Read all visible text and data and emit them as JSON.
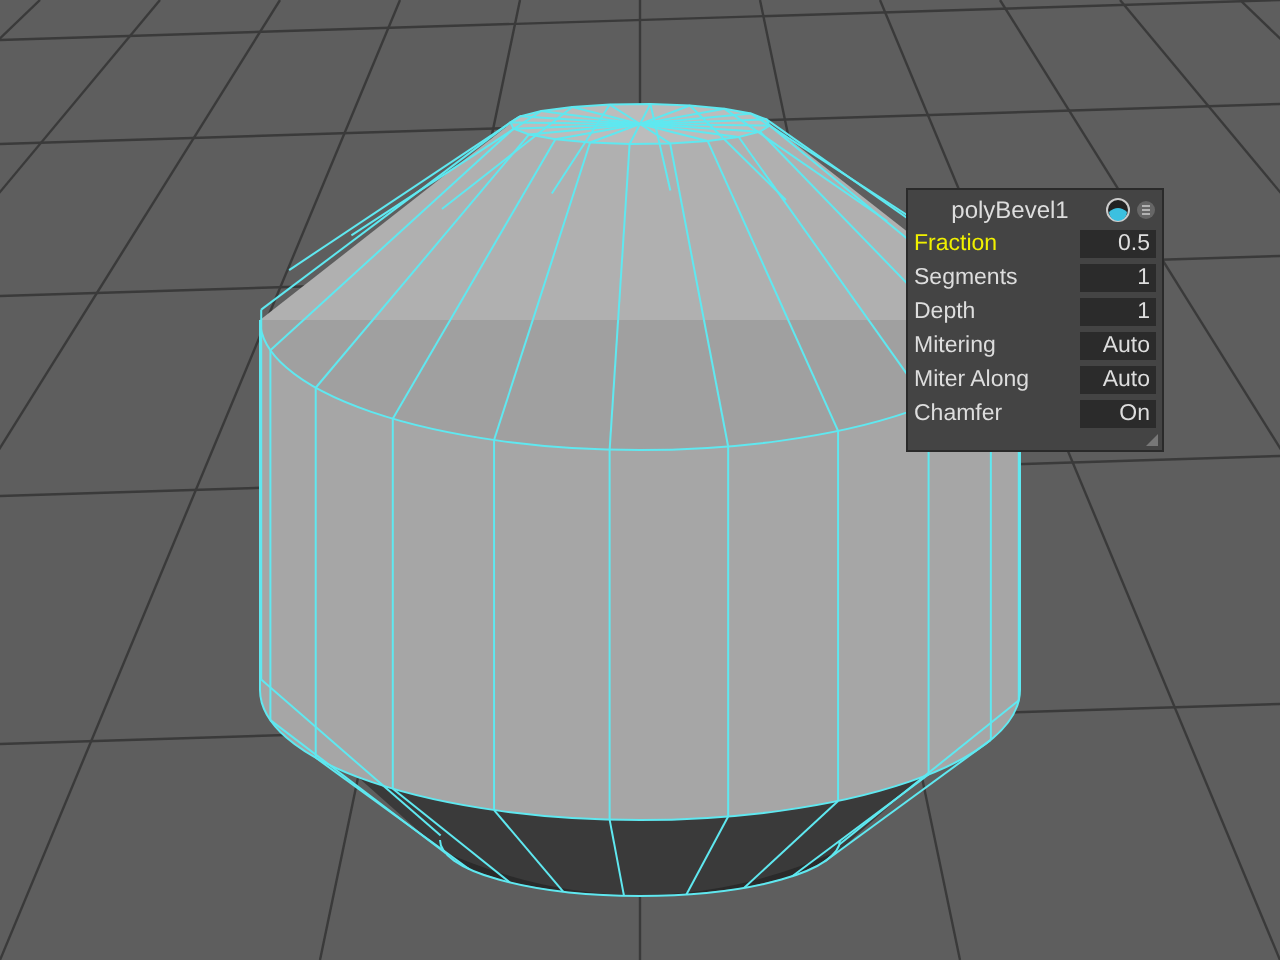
{
  "panel": {
    "title": "polyBevel1",
    "attributes": [
      {
        "label": "Fraction",
        "value": "0.5",
        "selected": true
      },
      {
        "label": "Segments",
        "value": "1",
        "selected": false
      },
      {
        "label": "Depth",
        "value": "1",
        "selected": false
      },
      {
        "label": "Mitering",
        "value": "Auto",
        "selected": false
      },
      {
        "label": "Miter Along",
        "value": "Auto",
        "selected": false
      },
      {
        "label": "Chamfer",
        "value": "On",
        "selected": false
      }
    ]
  }
}
